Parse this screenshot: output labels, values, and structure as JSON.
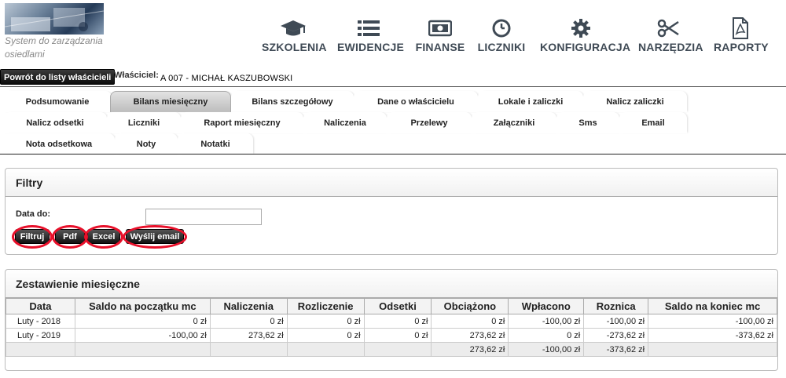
{
  "app": {
    "tagline": "System do zarządzania osiedlami"
  },
  "nav": [
    {
      "label": "SZKOLENIA",
      "icon": "graduation-cap-icon"
    },
    {
      "label": "EWIDENCJE",
      "icon": "list-icon"
    },
    {
      "label": "FINANSE",
      "icon": "money-icon"
    },
    {
      "label": "LICZNIKI",
      "icon": "clock-icon"
    },
    {
      "label": "KONFIGURACJA",
      "icon": "gear-icon"
    },
    {
      "label": "NARZĘDZIA",
      "icon": "scissors-icon"
    },
    {
      "label": "RAPORTY",
      "icon": "pdf-file-icon"
    }
  ],
  "owner": {
    "back_button": "Powrót do listy właścicieli",
    "label": "Właściciel:",
    "value": "A 007 - MICHAŁ KASZUBOWSKI"
  },
  "tabs": {
    "row1": [
      "Podsumowanie",
      "Bilans miesięczny",
      "Bilans szczegółowy",
      "Dane o właścicielu",
      "Lokale i zaliczki",
      "Nalicz zaliczki"
    ],
    "row2": [
      "Nalicz odsetki",
      "Liczniki",
      "Raport miesięczny",
      "Naliczenia",
      "Przelewy",
      "Załączniki",
      "Sms",
      "Email"
    ],
    "row3": [
      "Nota odsetkowa",
      "Noty",
      "Notatki"
    ],
    "active": "Bilans miesięczny"
  },
  "filters": {
    "title": "Filtry",
    "date_label": "Data do:",
    "date_value": "",
    "buttons": [
      "Filtruj",
      "Pdf",
      "Excel",
      "Wyślij email"
    ]
  },
  "summary": {
    "title": "Zestawienie miesięczne",
    "columns": [
      "Data",
      "Saldo na początku mc",
      "Naliczenia",
      "Rozliczenie",
      "Odsetki",
      "Obciążono",
      "Wpłacono",
      "Roznica",
      "Saldo na koniec mc"
    ],
    "rows": [
      [
        "Luty - 2018",
        "0 zł",
        "0 zł",
        "0 zł",
        "0 zł",
        "0 zł",
        "-100,00 zł",
        "-100,00 zł",
        "-100,00 zł"
      ],
      [
        "Luty - 2019",
        "-100,00 zł",
        "273,62 zł",
        "0 zł",
        "0 zł",
        "273,62 zł",
        "0 zł",
        "-273,62 zł",
        "-373,62 zł"
      ]
    ],
    "totals": [
      "",
      "",
      "",
      "",
      "",
      "273,62 zł",
      "-100,00 zł",
      "-373,62 zł",
      ""
    ]
  },
  "colors": {
    "highlight_ring": "#e8102a",
    "nav_text": "#3f4a55"
  }
}
